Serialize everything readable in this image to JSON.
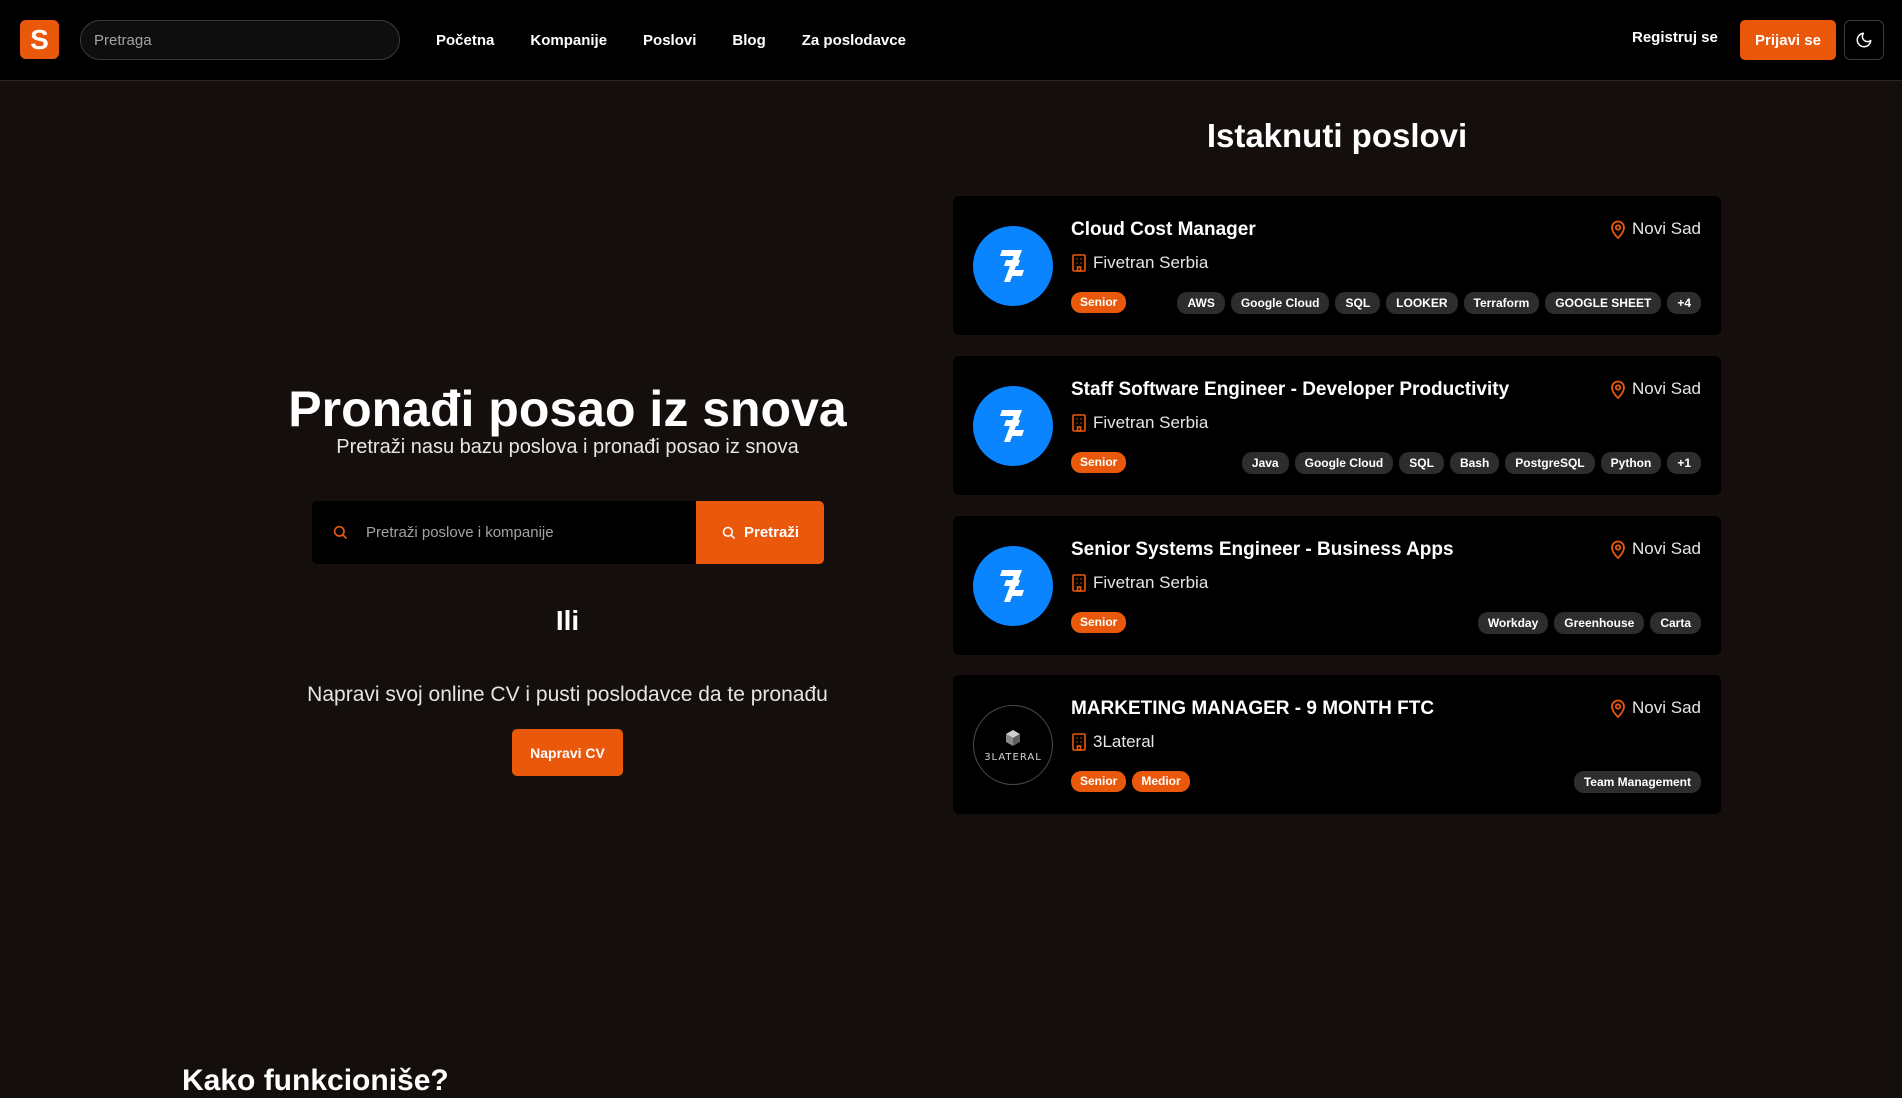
{
  "brand": {
    "logo_letter": "S",
    "accent": "#ea580c"
  },
  "nav": {
    "search_placeholder": "Pretraga",
    "links": [
      "Početna",
      "Kompanije",
      "Poslovi",
      "Blog",
      "Za poslodavce"
    ],
    "register": "Registruj se",
    "login": "Prijavi se",
    "theme_icon": "moon-icon"
  },
  "hero": {
    "title": "Pronađi posao iz snova",
    "subtitle": "Pretraži nasu bazu poslova i pronađi posao iz snova",
    "search_placeholder": "Pretraži poslove i kompanije",
    "search_button": "Pretraži",
    "or": "Ili",
    "cv_text": "Napravi svoj online CV i pusti poslodavce da te pronađu",
    "cv_button": "Napravi CV"
  },
  "bottom": {
    "heading": "Kako funkcioniše?"
  },
  "featured": {
    "title": "Istaknuti poslovi",
    "jobs": [
      {
        "title": "Cloud Cost Manager",
        "company": "Fivetran Serbia",
        "location": "Novi Sad",
        "logo": "fivetran-logo",
        "levels": [
          "Senior"
        ],
        "tags": [
          "AWS",
          "Google Cloud",
          "SQL",
          "LOOKER",
          "Terraform",
          "GOOGLE SHEET",
          "+4"
        ]
      },
      {
        "title": "Staff Software Engineer - Developer Productivity",
        "company": "Fivetran Serbia",
        "location": "Novi Sad",
        "logo": "fivetran-logo",
        "levels": [
          "Senior"
        ],
        "tags": [
          "Java",
          "Google Cloud",
          "SQL",
          "Bash",
          "PostgreSQL",
          "Python",
          "+1"
        ]
      },
      {
        "title": "Senior Systems Engineer - Business Apps",
        "company": "Fivetran Serbia",
        "location": "Novi Sad",
        "logo": "fivetran-logo",
        "levels": [
          "Senior"
        ],
        "tags": [
          "Workday",
          "Greenhouse",
          "Carta"
        ]
      },
      {
        "title": "MARKETING MANAGER - 9 MONTH FTC",
        "company": "3Lateral",
        "location": "Novi Sad",
        "logo": "3lateral-logo",
        "logo_text": "3LATERAL",
        "levels": [
          "Senior",
          "Medior"
        ],
        "tags": [
          "Team Management"
        ]
      }
    ]
  }
}
